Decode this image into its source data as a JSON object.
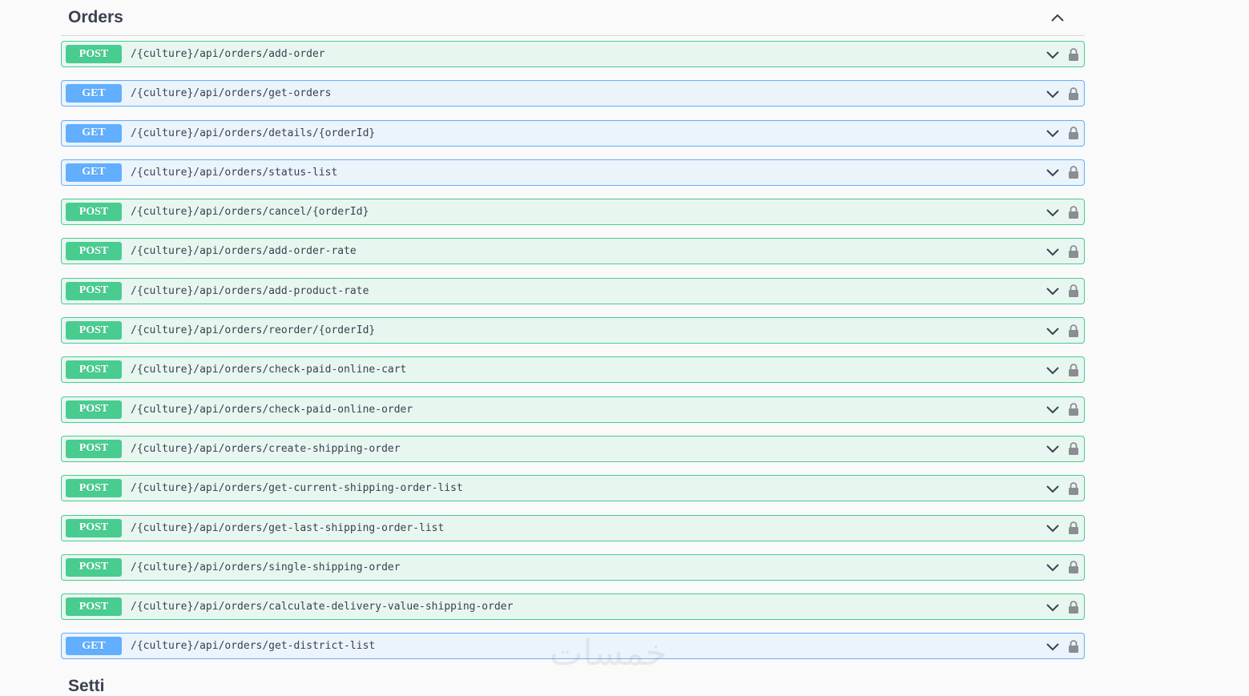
{
  "section": {
    "title": "Orders",
    "collapse_icon": "chevron-up-icon"
  },
  "operations": [
    {
      "method": "POST",
      "path": "/{culture}/api/orders/add-order"
    },
    {
      "method": "GET",
      "path": "/{culture}/api/orders/get-orders"
    },
    {
      "method": "GET",
      "path": "/{culture}/api/orders/details/{orderId}"
    },
    {
      "method": "GET",
      "path": "/{culture}/api/orders/status-list"
    },
    {
      "method": "POST",
      "path": "/{culture}/api/orders/cancel/{orderId}"
    },
    {
      "method": "POST",
      "path": "/{culture}/api/orders/add-order-rate"
    },
    {
      "method": "POST",
      "path": "/{culture}/api/orders/add-product-rate"
    },
    {
      "method": "POST",
      "path": "/{culture}/api/orders/reorder/{orderId}"
    },
    {
      "method": "POST",
      "path": "/{culture}/api/orders/check-paid-online-cart"
    },
    {
      "method": "POST",
      "path": "/{culture}/api/orders/check-paid-online-order"
    },
    {
      "method": "POST",
      "path": "/{culture}/api/orders/create-shipping-order"
    },
    {
      "method": "POST",
      "path": "/{culture}/api/orders/get-current-shipping-order-list"
    },
    {
      "method": "POST",
      "path": "/{culture}/api/orders/get-last-shipping-order-list"
    },
    {
      "method": "POST",
      "path": "/{culture}/api/orders/single-shipping-order"
    },
    {
      "method": "POST",
      "path": "/{culture}/api/orders/calculate-delivery-value-shipping-order"
    },
    {
      "method": "GET",
      "path": "/{culture}/api/orders/get-district-list"
    }
  ],
  "watermark": "خمسات",
  "next_section_title": "Setti",
  "colors": {
    "post": "#49cc90",
    "post_bg": "#e8f6f0",
    "get": "#61affe",
    "get_bg": "#ebf3fb",
    "text": "#3b4151"
  },
  "icons": {
    "expand": "chevron-down-icon",
    "auth": "lock-icon"
  }
}
